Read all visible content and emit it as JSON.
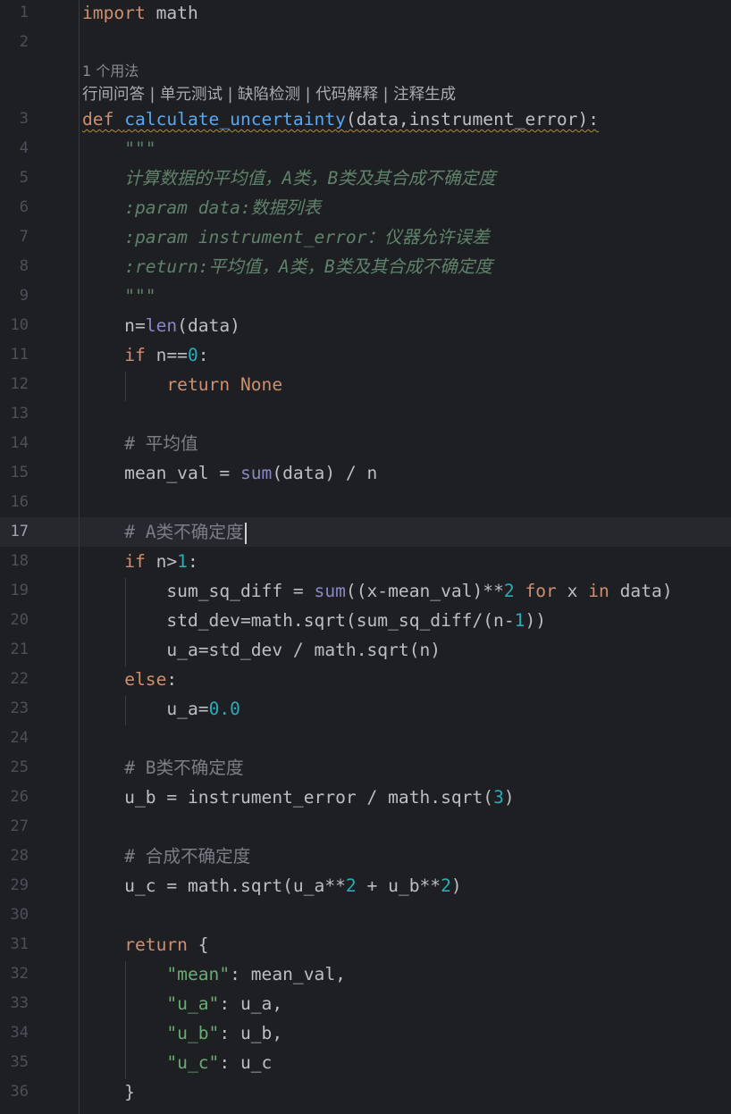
{
  "editor": {
    "usage_hint": "1 个用法",
    "inlay_actions": "行间问答 | 单元测试 | 缺陷检测 | 代码解释 | 注释生成",
    "current_line": 17,
    "lines": [
      {
        "n": "1",
        "code": "import math"
      },
      {
        "n": "2",
        "code": ""
      },
      {
        "n": "3",
        "code": "def calculate_uncertainty(data,instrument_error):"
      },
      {
        "n": "4",
        "code": "    \"\"\""
      },
      {
        "n": "5",
        "code": "    计算数据的平均值，A类，B类及其合成不确定度"
      },
      {
        "n": "6",
        "code": "    :param data:数据列表"
      },
      {
        "n": "7",
        "code": "    :param instrument_error：仪器允许误差"
      },
      {
        "n": "8",
        "code": "    :return:平均值，A类，B类及其合成不确定度"
      },
      {
        "n": "9",
        "code": "    \"\"\""
      },
      {
        "n": "10",
        "code": "    n=len(data)"
      },
      {
        "n": "11",
        "code": "    if n==0:"
      },
      {
        "n": "12",
        "code": "        return None"
      },
      {
        "n": "13",
        "code": ""
      },
      {
        "n": "14",
        "code": "    # 平均值"
      },
      {
        "n": "15",
        "code": "    mean_val = sum(data) / n"
      },
      {
        "n": "16",
        "code": ""
      },
      {
        "n": "17",
        "code": "    # A类不确定度"
      },
      {
        "n": "18",
        "code": "    if n>1:"
      },
      {
        "n": "19",
        "code": "        sum_sq_diff = sum((x-mean_val)**2 for x in data)"
      },
      {
        "n": "20",
        "code": "        std_dev=math.sqrt(sum_sq_diff/(n-1))"
      },
      {
        "n": "21",
        "code": "        u_a=std_dev / math.sqrt(n)"
      },
      {
        "n": "22",
        "code": "    else:"
      },
      {
        "n": "23",
        "code": "        u_a=0.0"
      },
      {
        "n": "24",
        "code": ""
      },
      {
        "n": "25",
        "code": "    # B类不确定度"
      },
      {
        "n": "26",
        "code": "    u_b = instrument_error / math.sqrt(3)"
      },
      {
        "n": "27",
        "code": ""
      },
      {
        "n": "28",
        "code": "    # 合成不确定度"
      },
      {
        "n": "29",
        "code": "    u_c = math.sqrt(u_a**2 + u_b**2)"
      },
      {
        "n": "30",
        "code": ""
      },
      {
        "n": "31",
        "code": "    return {"
      },
      {
        "n": "32",
        "code": "        \"mean\": mean_val,"
      },
      {
        "n": "33",
        "code": "        \"u_a\": u_a,"
      },
      {
        "n": "34",
        "code": "        \"u_b\": u_b,"
      },
      {
        "n": "35",
        "code": "        \"u_c\": u_c"
      },
      {
        "n": "36",
        "code": "    }"
      }
    ]
  },
  "colors": {
    "background": "#1e1f22",
    "keyword": "#cf8e6d",
    "function": "#56a8f5",
    "builtin": "#8888c6",
    "number": "#2aacb8",
    "string": "#6aab73",
    "docstring": "#5f826b",
    "comment": "#7a7e85",
    "text": "#bcbec4"
  }
}
